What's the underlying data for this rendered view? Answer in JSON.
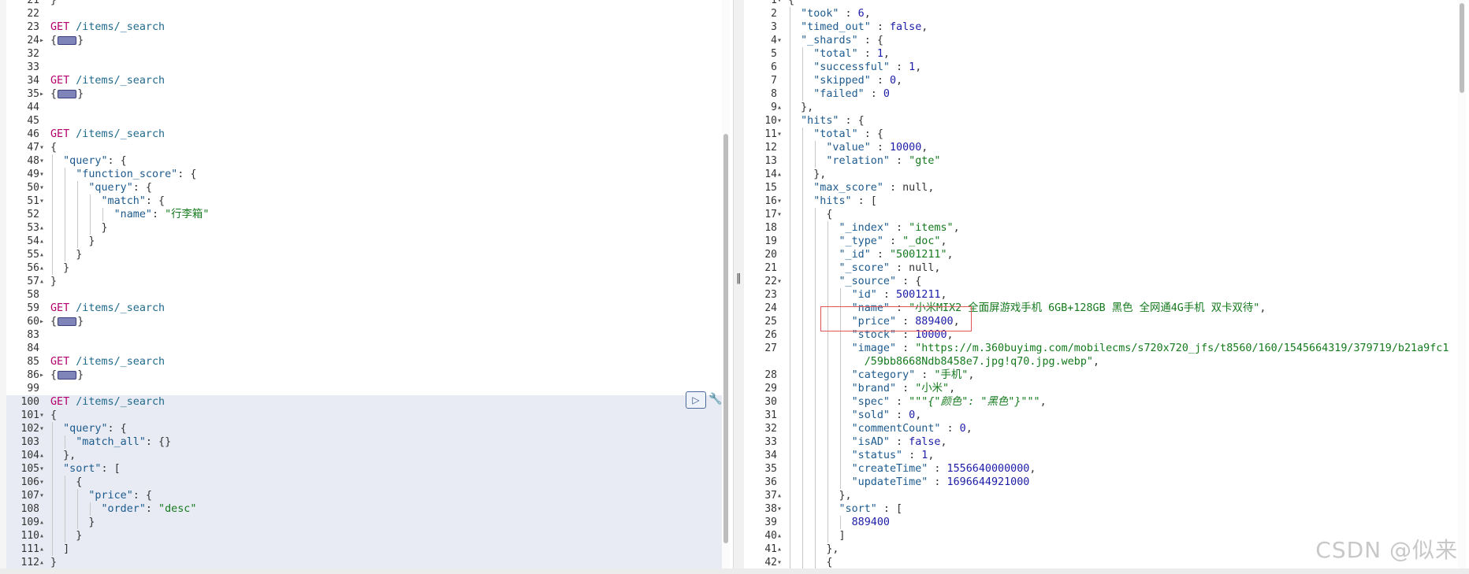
{
  "editor": {
    "lines": [
      {
        "n": "21",
        "fold": "",
        "indent": 0,
        "html": "}",
        "guides": 0
      },
      {
        "n": "22",
        "fold": "",
        "indent": 0,
        "html": "",
        "guides": 0
      },
      {
        "n": "23",
        "fold": "",
        "indent": 0,
        "html": "<span class='m'>GET</span> <span class='u'>/items/_search</span>",
        "guides": 0
      },
      {
        "n": "24",
        "fold": "▸",
        "indent": 0,
        "html": "{<span class='collapsed'></span>}",
        "guides": 0
      },
      {
        "n": "32",
        "fold": "",
        "indent": 0,
        "html": "",
        "guides": 0
      },
      {
        "n": "33",
        "fold": "",
        "indent": 0,
        "html": "",
        "guides": 0
      },
      {
        "n": "34",
        "fold": "",
        "indent": 0,
        "html": "<span class='m'>GET</span> <span class='u'>/items/_search</span>",
        "guides": 0
      },
      {
        "n": "35",
        "fold": "▸",
        "indent": 0,
        "html": "{<span class='collapsed'></span>}",
        "guides": 0
      },
      {
        "n": "44",
        "fold": "",
        "indent": 0,
        "html": "",
        "guides": 0
      },
      {
        "n": "45",
        "fold": "",
        "indent": 0,
        "html": "",
        "guides": 0
      },
      {
        "n": "46",
        "fold": "",
        "indent": 0,
        "html": "<span class='m'>GET</span> <span class='u'>/items/_search</span>",
        "guides": 0
      },
      {
        "n": "47",
        "fold": "▾",
        "indent": 0,
        "html": "{",
        "guides": 0
      },
      {
        "n": "48",
        "fold": "▾",
        "indent": 1,
        "html": "<span class='k'>\"query\"</span>: {",
        "guides": 1
      },
      {
        "n": "49",
        "fold": "▾",
        "indent": 2,
        "html": "<span class='k'>\"function_score\"</span>: {",
        "guides": 2
      },
      {
        "n": "50",
        "fold": "▾",
        "indent": 3,
        "html": "<span class='k'>\"query\"</span>: {",
        "guides": 3
      },
      {
        "n": "51",
        "fold": "▾",
        "indent": 4,
        "html": "<span class='k'>\"match\"</span>: {",
        "guides": 4
      },
      {
        "n": "52",
        "fold": "",
        "indent": 5,
        "html": "<span class='k'>\"name\"</span>: <span class='s'>\"行李箱\"</span>",
        "guides": 5
      },
      {
        "n": "53",
        "fold": "▴",
        "indent": 4,
        "html": "}",
        "guides": 4
      },
      {
        "n": "54",
        "fold": "▴",
        "indent": 3,
        "html": "}",
        "guides": 3
      },
      {
        "n": "55",
        "fold": "▴",
        "indent": 2,
        "html": "}",
        "guides": 2
      },
      {
        "n": "56",
        "fold": "▴",
        "indent": 1,
        "html": "}",
        "guides": 1
      },
      {
        "n": "57",
        "fold": "▴",
        "indent": 0,
        "html": "}",
        "guides": 0
      },
      {
        "n": "58",
        "fold": "",
        "indent": 0,
        "html": "",
        "guides": 0
      },
      {
        "n": "59",
        "fold": "",
        "indent": 0,
        "html": "<span class='m'>GET</span> <span class='u'>/items/_search</span>",
        "guides": 0
      },
      {
        "n": "60",
        "fold": "▸",
        "indent": 0,
        "html": "{<span class='collapsed'></span>}",
        "guides": 0
      },
      {
        "n": "83",
        "fold": "",
        "indent": 0,
        "html": "",
        "guides": 0
      },
      {
        "n": "84",
        "fold": "",
        "indent": 0,
        "html": "",
        "guides": 0
      },
      {
        "n": "85",
        "fold": "",
        "indent": 0,
        "html": "<span class='m'>GET</span> <span class='u'>/items/_search</span>",
        "guides": 0
      },
      {
        "n": "86",
        "fold": "▸",
        "indent": 0,
        "html": "{<span class='collapsed'></span>}",
        "guides": 0
      },
      {
        "n": "99",
        "fold": "",
        "indent": 0,
        "html": "",
        "guides": 0
      },
      {
        "n": "100",
        "fold": "",
        "indent": 0,
        "html": "<span class='m'>GET</span> <span class='u'>/items/_search</span>",
        "guides": 0,
        "hl": true
      },
      {
        "n": "101",
        "fold": "▾",
        "indent": 0,
        "html": "{",
        "guides": 0,
        "hl": true
      },
      {
        "n": "102",
        "fold": "▾",
        "indent": 1,
        "html": "<span class='k'>\"query\"</span>: {",
        "guides": 1,
        "hl": true
      },
      {
        "n": "103",
        "fold": "",
        "indent": 2,
        "html": "<span class='k'>\"match_all\"</span>: {}",
        "guides": 2,
        "hl": true
      },
      {
        "n": "104",
        "fold": "▴",
        "indent": 1,
        "html": "},",
        "guides": 1,
        "hl": true
      },
      {
        "n": "105",
        "fold": "▾",
        "indent": 1,
        "html": "<span class='k'>\"sort\"</span>: [",
        "guides": 1,
        "hl": true
      },
      {
        "n": "106",
        "fold": "▾",
        "indent": 2,
        "html": "{",
        "guides": 2,
        "hl": true
      },
      {
        "n": "107",
        "fold": "▾",
        "indent": 3,
        "html": "<span class='k'>\"price\"</span>: {",
        "guides": 3,
        "hl": true
      },
      {
        "n": "108",
        "fold": "",
        "indent": 4,
        "html": "<span class='k'>\"order\"</span>: <span class='s'>\"desc\"</span>",
        "guides": 4,
        "hl": true
      },
      {
        "n": "109",
        "fold": "▴",
        "indent": 3,
        "html": "}",
        "guides": 3,
        "hl": true
      },
      {
        "n": "110",
        "fold": "▴",
        "indent": 2,
        "html": "}",
        "guides": 2,
        "hl": true
      },
      {
        "n": "111",
        "fold": "▴",
        "indent": 1,
        "html": "]",
        "guides": 1,
        "hl": true
      },
      {
        "n": "112",
        "fold": "▴",
        "indent": 0,
        "html": "}",
        "guides": 0,
        "hl": true
      }
    ],
    "run_icon": "▷",
    "wrench_icon": "🔧"
  },
  "divider_glyph": "‖",
  "output": {
    "lines": [
      {
        "n": "1",
        "fold": "▾",
        "indent": 0,
        "html": "{",
        "guides": 0
      },
      {
        "n": "2",
        "fold": "",
        "indent": 1,
        "html": "<span class='k'>\"took\"</span> : <span class='n'>6</span>,",
        "guides": 1
      },
      {
        "n": "3",
        "fold": "",
        "indent": 1,
        "html": "<span class='k'>\"timed_out\"</span> : <span class='b'>false</span>,",
        "guides": 1
      },
      {
        "n": "4",
        "fold": "▾",
        "indent": 1,
        "html": "<span class='k'>\"_shards\"</span> : {",
        "guides": 1
      },
      {
        "n": "5",
        "fold": "",
        "indent": 2,
        "html": "<span class='k'>\"total\"</span> : <span class='n'>1</span>,",
        "guides": 2
      },
      {
        "n": "6",
        "fold": "",
        "indent": 2,
        "html": "<span class='k'>\"successful\"</span> : <span class='n'>1</span>,",
        "guides": 2
      },
      {
        "n": "7",
        "fold": "",
        "indent": 2,
        "html": "<span class='k'>\"skipped\"</span> : <span class='n'>0</span>,",
        "guides": 2
      },
      {
        "n": "8",
        "fold": "",
        "indent": 2,
        "html": "<span class='k'>\"failed\"</span> : <span class='n'>0</span>",
        "guides": 2
      },
      {
        "n": "9",
        "fold": "▴",
        "indent": 1,
        "html": "},",
        "guides": 1
      },
      {
        "n": "10",
        "fold": "▾",
        "indent": 1,
        "html": "<span class='k'>\"hits\"</span> : {",
        "guides": 1
      },
      {
        "n": "11",
        "fold": "▾",
        "indent": 2,
        "html": "<span class='k'>\"total\"</span> : {",
        "guides": 2
      },
      {
        "n": "12",
        "fold": "",
        "indent": 3,
        "html": "<span class='k'>\"value\"</span> : <span class='n'>10000</span>,",
        "guides": 3
      },
      {
        "n": "13",
        "fold": "",
        "indent": 3,
        "html": "<span class='k'>\"relation\"</span> : <span class='s'>\"gte\"</span>",
        "guides": 3
      },
      {
        "n": "14",
        "fold": "▴",
        "indent": 2,
        "html": "},",
        "guides": 2
      },
      {
        "n": "15",
        "fold": "",
        "indent": 2,
        "html": "<span class='k'>\"max_score\"</span> : <span class='p'>null</span>,",
        "guides": 2
      },
      {
        "n": "16",
        "fold": "▾",
        "indent": 2,
        "html": "<span class='k'>\"hits\"</span> : [",
        "guides": 2
      },
      {
        "n": "17",
        "fold": "▾",
        "indent": 3,
        "html": "{",
        "guides": 3
      },
      {
        "n": "18",
        "fold": "",
        "indent": 4,
        "html": "<span class='k'>\"_index\"</span> : <span class='s'>\"items\"</span>,",
        "guides": 4
      },
      {
        "n": "19",
        "fold": "",
        "indent": 4,
        "html": "<span class='k'>\"_type\"</span> : <span class='s'>\"_doc\"</span>,",
        "guides": 4
      },
      {
        "n": "20",
        "fold": "",
        "indent": 4,
        "html": "<span class='k'>\"_id\"</span> : <span class='s'>\"5001211\"</span>,",
        "guides": 4
      },
      {
        "n": "21",
        "fold": "",
        "indent": 4,
        "html": "<span class='k'>\"_score\"</span> : <span class='p'>null</span>,",
        "guides": 4
      },
      {
        "n": "22",
        "fold": "▾",
        "indent": 4,
        "html": "<span class='k'>\"_source\"</span> : {",
        "guides": 4
      },
      {
        "n": "23",
        "fold": "",
        "indent": 5,
        "html": "<span class='k'>\"id\"</span> : <span class='n'>5001211</span>,",
        "guides": 5
      },
      {
        "n": "24",
        "fold": "",
        "indent": 5,
        "html": "<span class='k'>\"name\"</span> : <span class='s'>\"小米MIX2 全面屏游戏手机 6GB+128GB 黑色 全网通4G手机 双卡双待\"</span>,",
        "guides": 5
      },
      {
        "n": "25",
        "fold": "",
        "indent": 5,
        "html": "<span class='k'>\"price\"</span> : <span class='n'>889400</span>,",
        "guides": 5
      },
      {
        "n": "26",
        "fold": "",
        "indent": 5,
        "html": "<span class='k'>\"stock\"</span> : <span class='n'>10000</span>,",
        "guides": 5
      },
      {
        "n": "27",
        "fold": "",
        "indent": 5,
        "html": "<span class='k'>\"image\"</span> : <span class='s'>\"https://m.360buyimg.com/mobilecms/s720x720_jfs/t8560/160/1545664319/379719/b21a9fc1</span>",
        "guides": 5
      },
      {
        "n": "",
        "fold": "",
        "indent": 6,
        "html": "<span class='s'>/59bb8668Ndb8458e7.jpg!q70.jpg.webp\"</span>,",
        "guides": 5
      },
      {
        "n": "28",
        "fold": "",
        "indent": 5,
        "html": "<span class='k'>\"category\"</span> : <span class='s'>\"手机\"</span>,",
        "guides": 5
      },
      {
        "n": "29",
        "fold": "",
        "indent": 5,
        "html": "<span class='k'>\"brand\"</span> : <span class='s'>\"小米\"</span>,",
        "guides": 5
      },
      {
        "n": "30",
        "fold": "",
        "indent": 5,
        "html": "<span class='k'>\"spec\"</span> : <span class='s'>\"\"\"<span class='i'>{\"颜色\": \"黑色\"}</span>\"\"\"</span>,",
        "guides": 5
      },
      {
        "n": "31",
        "fold": "",
        "indent": 5,
        "html": "<span class='k'>\"sold\"</span> : <span class='n'>0</span>,",
        "guides": 5
      },
      {
        "n": "32",
        "fold": "",
        "indent": 5,
        "html": "<span class='k'>\"commentCount\"</span> : <span class='n'>0</span>,",
        "guides": 5
      },
      {
        "n": "33",
        "fold": "",
        "indent": 5,
        "html": "<span class='k'>\"isAD\"</span> : <span class='b'>false</span>,",
        "guides": 5
      },
      {
        "n": "34",
        "fold": "",
        "indent": 5,
        "html": "<span class='k'>\"status\"</span> : <span class='n'>1</span>,",
        "guides": 5
      },
      {
        "n": "35",
        "fold": "",
        "indent": 5,
        "html": "<span class='k'>\"createTime\"</span> : <span class='n'>1556640000000</span>,",
        "guides": 5
      },
      {
        "n": "36",
        "fold": "",
        "indent": 5,
        "html": "<span class='k'>\"updateTime\"</span> : <span class='n'>1696644921000</span>",
        "guides": 5
      },
      {
        "n": "37",
        "fold": "▴",
        "indent": 4,
        "html": "},",
        "guides": 4
      },
      {
        "n": "38",
        "fold": "▾",
        "indent": 4,
        "html": "<span class='k'>\"sort\"</span> : [",
        "guides": 4
      },
      {
        "n": "39",
        "fold": "",
        "indent": 5,
        "html": "<span class='n'>889400</span>",
        "guides": 5
      },
      {
        "n": "40",
        "fold": "▴",
        "indent": 4,
        "html": "]",
        "guides": 4
      },
      {
        "n": "41",
        "fold": "▴",
        "indent": 3,
        "html": "},",
        "guides": 3
      },
      {
        "n": "42",
        "fold": "▾",
        "indent": 3,
        "html": "{",
        "guides": 3
      }
    ]
  },
  "watermark": "CSDN @似来"
}
